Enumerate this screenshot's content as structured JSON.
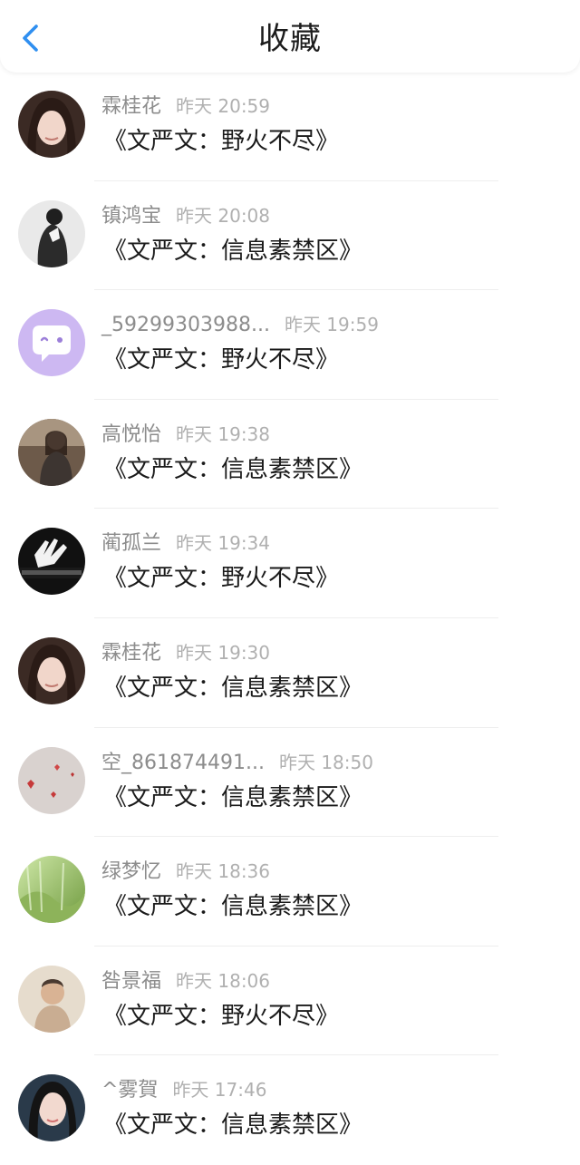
{
  "header": {
    "title": "收藏",
    "back_icon": "chevron-left-icon",
    "accent_color": "#2f8ff0"
  },
  "items": [
    {
      "name": "霖桂花",
      "time": "昨天 20:59",
      "title": "《文严文：野火不尽》",
      "avatar": "avatar-1"
    },
    {
      "name": "镇鸿宝",
      "time": "昨天 20:08",
      "title": "《文严文：信息素禁区》",
      "avatar": "avatar-2"
    },
    {
      "name": "_59299303988...",
      "time": "昨天 19:59",
      "title": "《文严文：野火不尽》",
      "avatar": "avatar-3"
    },
    {
      "name": "高悦怡",
      "time": "昨天 19:38",
      "title": "《文严文：信息素禁区》",
      "avatar": "avatar-4"
    },
    {
      "name": "蔺孤兰",
      "time": "昨天 19:34",
      "title": "《文严文：野火不尽》",
      "avatar": "avatar-5"
    },
    {
      "name": "霖桂花",
      "time": "昨天 19:30",
      "title": "《文严文：信息素禁区》",
      "avatar": "avatar-1"
    },
    {
      "name": "空_861874491...",
      "time": "昨天 18:50",
      "title": "《文严文：信息素禁区》",
      "avatar": "avatar-7"
    },
    {
      "name": "绿梦忆",
      "time": "昨天 18:36",
      "title": "《文严文：信息素禁区》",
      "avatar": "avatar-8"
    },
    {
      "name": "咎景福",
      "time": "昨天 18:06",
      "title": "《文严文：野火不尽》",
      "avatar": "avatar-9"
    },
    {
      "name": "^雾賀",
      "time": "昨天 17:46",
      "title": "《文严文：信息素禁区》",
      "avatar": "avatar-10"
    }
  ]
}
